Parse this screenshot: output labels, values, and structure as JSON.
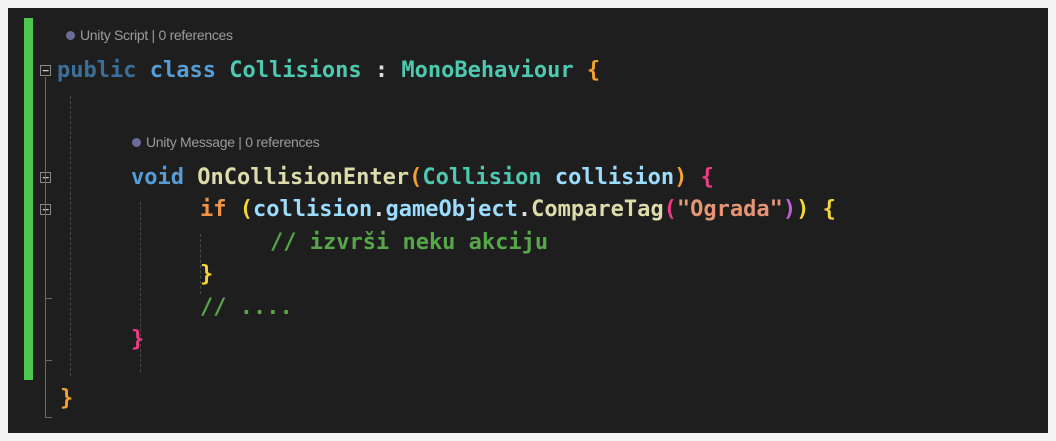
{
  "codelens": {
    "class_lens": "Unity Script | 0 references",
    "method_lens": "Unity Message | 0 references"
  },
  "fold_glyph": "−",
  "code": {
    "line1": {
      "public": "public",
      "class": "class",
      "name": "Collisions",
      "colon": " : ",
      "base": "MonoBehaviour",
      "open": "{"
    },
    "line2": {
      "void": "void",
      "method": "OnCollisionEnter",
      "open_paren": "(",
      "param_type": "Collision",
      "param_name": "collision",
      "close_paren": ")",
      "open": "{"
    },
    "line3": {
      "if": "if",
      "open_paren": "(",
      "obj": "collision",
      "dot1": ".",
      "prop": "gameObject",
      "dot2": ".",
      "method": "CompareTag",
      "call_open": "(",
      "string": "\"Ograda\"",
      "call_close": ")",
      "close_paren": ")",
      "open": "{"
    },
    "line4": {
      "comment": "// izvrši neku akciju"
    },
    "line5": {
      "close": "}"
    },
    "line6": {
      "comment": "// ...."
    },
    "line7": {
      "close": "}"
    },
    "line8": {
      "close": "}"
    }
  },
  "colors": {
    "background": "#1e1e1e",
    "change_bar": "#4ec74f",
    "keyword": "#569cd6",
    "type": "#4ec9b0",
    "method": "#dcdcaa",
    "parameter": "#9cdcfe",
    "string": "#e39575",
    "comment": "#57a64a"
  }
}
